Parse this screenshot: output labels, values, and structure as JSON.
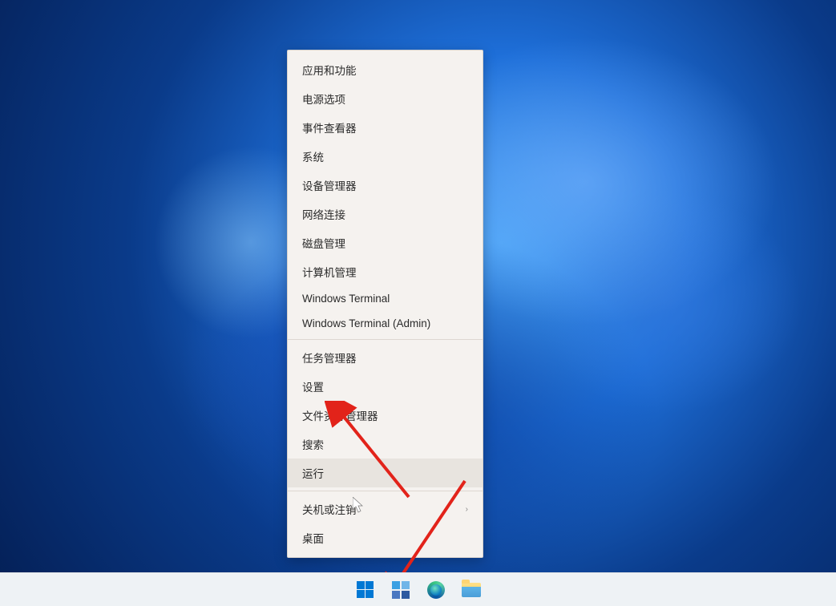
{
  "context_menu": {
    "items": [
      {
        "label": "应用和功能",
        "type": "item"
      },
      {
        "label": "电源选项",
        "type": "item"
      },
      {
        "label": "事件查看器",
        "type": "item"
      },
      {
        "label": "系统",
        "type": "item"
      },
      {
        "label": "设备管理器",
        "type": "item"
      },
      {
        "label": "网络连接",
        "type": "item"
      },
      {
        "label": "磁盘管理",
        "type": "item"
      },
      {
        "label": "计算机管理",
        "type": "item"
      },
      {
        "label": "Windows Terminal",
        "type": "item"
      },
      {
        "label": "Windows Terminal (Admin)",
        "type": "item"
      },
      {
        "type": "divider"
      },
      {
        "label": "任务管理器",
        "type": "item"
      },
      {
        "label": "设置",
        "type": "item"
      },
      {
        "label": "文件资源管理器",
        "type": "item"
      },
      {
        "label": "搜索",
        "type": "item"
      },
      {
        "label": "运行",
        "type": "item",
        "hover": true
      },
      {
        "type": "divider"
      },
      {
        "label": "关机或注销",
        "type": "item",
        "submenu": true
      },
      {
        "label": "桌面",
        "type": "item"
      }
    ]
  },
  "taskbar_icons": [
    "start",
    "widgets",
    "edge",
    "file-explorer"
  ],
  "annotation_color": "#e2231a"
}
